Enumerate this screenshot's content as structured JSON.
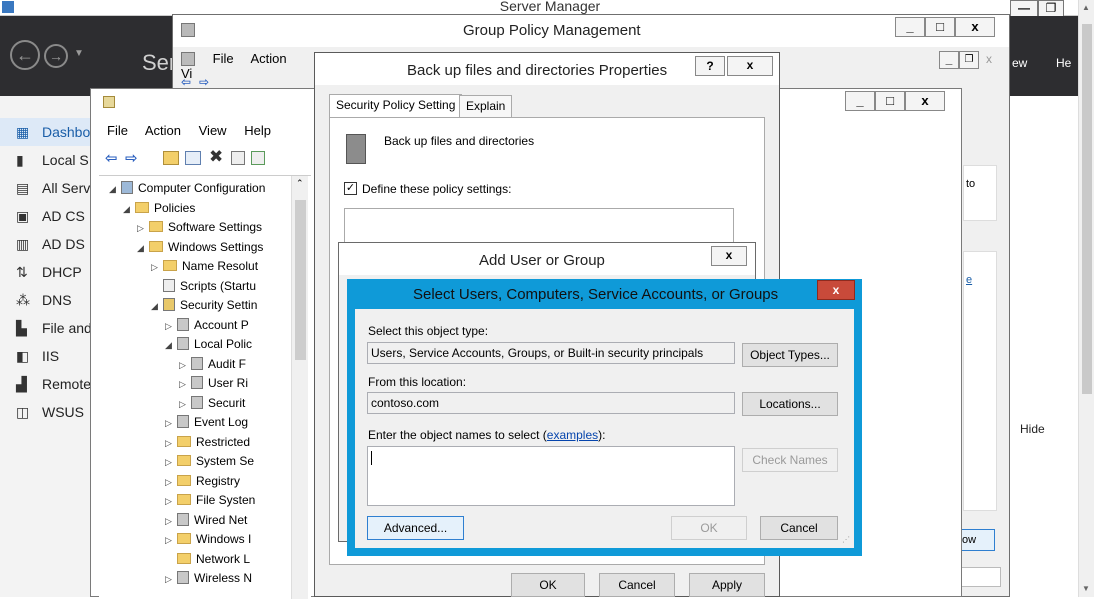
{
  "server_manager": {
    "title": "Server Manager",
    "header_prefix": "Ser",
    "header_view": "ew",
    "header_help": "He",
    "nav": [
      {
        "label": "Dashbo",
        "icon": "dashboard-icon"
      },
      {
        "label": "Local S",
        "icon": "server-icon"
      },
      {
        "label": "All Serv",
        "icon": "servers-icon"
      },
      {
        "label": "AD CS",
        "icon": "certificate-icon"
      },
      {
        "label": "AD DS",
        "icon": "directory-icon"
      },
      {
        "label": "DHCP",
        "icon": "dhcp-icon"
      },
      {
        "label": "DNS",
        "icon": "dns-icon"
      },
      {
        "label": "File and",
        "icon": "file-services-icon"
      },
      {
        "label": "IIS",
        "icon": "iis-icon"
      },
      {
        "label": "Remote",
        "icon": "remote-icon"
      },
      {
        "label": "WSUS",
        "icon": "wsus-icon"
      }
    ],
    "hide_label": "Hide",
    "right_to": "to",
    "right_e": "e"
  },
  "gpm": {
    "title": "Group Policy Management",
    "menu": [
      "File",
      "Action",
      "Vi"
    ]
  },
  "gpme": {
    "menu": [
      "File",
      "Action",
      "View",
      "Help"
    ],
    "ok_partial": "ow",
    "tree": [
      {
        "label": "Computer Configuration",
        "indent": 0,
        "arrow": "◢",
        "icon": "computer"
      },
      {
        "label": "Policies",
        "indent": 1,
        "arrow": "◢",
        "icon": "folder"
      },
      {
        "label": "Software Settings",
        "indent": 2,
        "arrow": "▷",
        "icon": "folder"
      },
      {
        "label": "Windows Settings",
        "indent": 2,
        "arrow": "◢",
        "icon": "folder"
      },
      {
        "label": "Name Resolut",
        "indent": 3,
        "arrow": "▷",
        "icon": "folder"
      },
      {
        "label": "Scripts (Startu",
        "indent": 3,
        "arrow": "",
        "icon": "script"
      },
      {
        "label": "Security Settin",
        "indent": 3,
        "arrow": "◢",
        "icon": "security"
      },
      {
        "label": "Account P",
        "indent": 4,
        "arrow": "▷",
        "icon": "policy"
      },
      {
        "label": "Local Polic",
        "indent": 4,
        "arrow": "◢",
        "icon": "policy"
      },
      {
        "label": "Audit F",
        "indent": 5,
        "arrow": "▷",
        "icon": "policy"
      },
      {
        "label": "User Ri",
        "indent": 5,
        "arrow": "▷",
        "icon": "policy"
      },
      {
        "label": "Securit",
        "indent": 5,
        "arrow": "▷",
        "icon": "policy"
      },
      {
        "label": "Event Log",
        "indent": 4,
        "arrow": "▷",
        "icon": "policy"
      },
      {
        "label": "Restricted",
        "indent": 4,
        "arrow": "▷",
        "icon": "folder"
      },
      {
        "label": "System Se",
        "indent": 4,
        "arrow": "▷",
        "icon": "folder"
      },
      {
        "label": "Registry",
        "indent": 4,
        "arrow": "▷",
        "icon": "folder"
      },
      {
        "label": "File Systen",
        "indent": 4,
        "arrow": "▷",
        "icon": "folder"
      },
      {
        "label": "Wired Net",
        "indent": 4,
        "arrow": "▷",
        "icon": "policy"
      },
      {
        "label": "Windows I",
        "indent": 4,
        "arrow": "▷",
        "icon": "folder"
      },
      {
        "label": "Network L",
        "indent": 4,
        "arrow": "",
        "icon": "folder"
      },
      {
        "label": "Wireless N",
        "indent": 4,
        "arrow": "▷",
        "icon": "policy"
      }
    ]
  },
  "props": {
    "title": "Back up files and directories Properties",
    "help": "?",
    "close": "x",
    "tabs": [
      "Security Policy Setting",
      "Explain"
    ],
    "policy_name": "Back up files and directories",
    "define_label": "Define these policy settings:",
    "ok": "OK",
    "cancel": "Cancel",
    "apply": "Apply"
  },
  "aug": {
    "title": "Add User or Group",
    "close": "x"
  },
  "sel": {
    "title": "Select Users, Computers, Service Accounts, or Groups",
    "close": "x",
    "object_type_label": "Select this object type:",
    "object_type_value": "Users, Service Accounts, Groups, or Built-in security principals",
    "object_types_btn": "Object Types...",
    "location_label": "From this location:",
    "location_value": "contoso.com",
    "locations_btn": "Locations...",
    "enter_label_prefix": "Enter the object names to select (",
    "examples_link": "examples",
    "enter_label_suffix": "):",
    "check_names_btn": "Check Names",
    "advanced_btn": "Advanced...",
    "ok": "OK",
    "cancel": "Cancel"
  }
}
